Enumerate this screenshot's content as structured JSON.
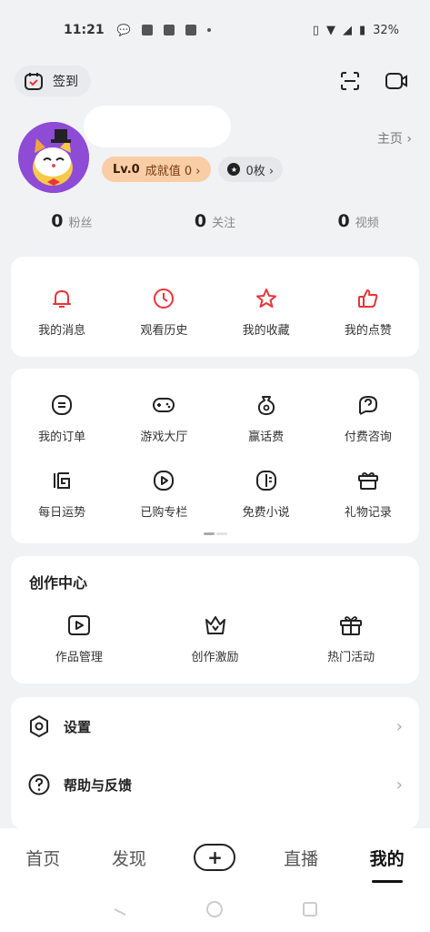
{
  "status": {
    "time": "11:21",
    "battery": "32%"
  },
  "top": {
    "checkin_label": "签到"
  },
  "profile": {
    "homepage_link": "主页 ›",
    "level": "Lv.0",
    "achievement": "成就值 0 ›",
    "coins": "0枚 ›"
  },
  "stats": [
    {
      "num": "0",
      "label": "粉丝"
    },
    {
      "num": "0",
      "label": "关注"
    },
    {
      "num": "0",
      "label": "视频"
    }
  ],
  "quick": [
    {
      "label": "我的消息",
      "icon": "bell-icon"
    },
    {
      "label": "观看历史",
      "icon": "clock-icon"
    },
    {
      "label": "我的收藏",
      "icon": "star-icon"
    },
    {
      "label": "我的点赞",
      "icon": "thumbs-up-icon"
    }
  ],
  "services": [
    {
      "label": "我的订单",
      "icon": "order-icon"
    },
    {
      "label": "游戏大厅",
      "icon": "gamepad-icon"
    },
    {
      "label": "赢话费",
      "icon": "money-bag-icon"
    },
    {
      "label": "付费咨询",
      "icon": "consult-icon"
    },
    {
      "label": "每日运势",
      "icon": "fortune-icon"
    },
    {
      "label": "已购专栏",
      "icon": "play-box-icon"
    },
    {
      "label": "免费小说",
      "icon": "book-icon"
    },
    {
      "label": "礼物记录",
      "icon": "gift-icon"
    }
  ],
  "creation": {
    "title": "创作中心",
    "items": [
      {
        "label": "作品管理",
        "icon": "video-play-icon"
      },
      {
        "label": "创作激励",
        "icon": "crown-icon"
      },
      {
        "label": "热门活动",
        "icon": "gift-box-icon"
      }
    ]
  },
  "menu": [
    {
      "label": "设置",
      "icon": "settings-icon"
    },
    {
      "label": "帮助与反馈",
      "icon": "help-icon"
    }
  ],
  "tabs": [
    {
      "label": "首页"
    },
    {
      "label": "发现"
    },
    {
      "label": "+"
    },
    {
      "label": "直播"
    },
    {
      "label": "我的"
    }
  ],
  "colors": {
    "accent_red": "#e8343a",
    "level_badge": "#f9cda6",
    "avatar_bg": "#8d4bd6"
  }
}
